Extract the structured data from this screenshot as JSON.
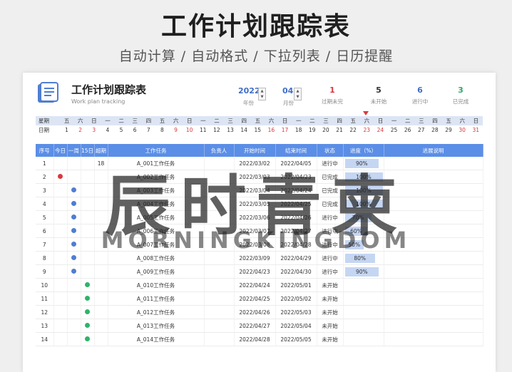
{
  "banner": {
    "title": "工作计划跟踪表",
    "subtitle": "自动计算 / 自动格式 / 下拉列表 / 日历提醒"
  },
  "header": {
    "title": "工作计划跟踪表",
    "subtitle": "Work plan tracking",
    "year": {
      "value": "2022",
      "label": "年份"
    },
    "month": {
      "value": "04",
      "label": "月份"
    },
    "stats": [
      {
        "value": "1",
        "label": "过期未完",
        "color": "#d9393e"
      },
      {
        "value": "5",
        "label": "未开始",
        "color": "#333333"
      },
      {
        "value": "6",
        "label": "进行中",
        "color": "#3f6dc9"
      },
      {
        "value": "3",
        "label": "已完成",
        "color": "#2fa866"
      }
    ]
  },
  "calendar": {
    "weekday_label": "星期",
    "date_label": "日期",
    "weekdays": [
      "五",
      "六",
      "日",
      "一",
      "二",
      "三",
      "四",
      "五",
      "六",
      "日",
      "一",
      "二",
      "三",
      "四",
      "五",
      "六",
      "日",
      "一",
      "二",
      "三",
      "四",
      "五",
      "六",
      "日",
      "一",
      "二",
      "三",
      "四",
      "五",
      "六",
      "日"
    ],
    "dates": [
      "1",
      "2",
      "3",
      "4",
      "5",
      "6",
      "7",
      "8",
      "9",
      "10",
      "11",
      "12",
      "13",
      "14",
      "15",
      "16",
      "17",
      "18",
      "19",
      "20",
      "21",
      "22",
      "23",
      "24",
      "25",
      "26",
      "27",
      "28",
      "29",
      "30",
      "31"
    ],
    "weekend_color": "#d9393e",
    "today_marker_date": "23"
  },
  "table": {
    "columns": [
      "序号",
      "今日",
      "一周",
      "15日",
      "超期",
      "工作任务",
      "负责人",
      "开始时间",
      "结束时间",
      "状态",
      "进度（%）",
      "进展说明"
    ],
    "rows": [
      {
        "no": "1",
        "dot": "",
        "dot_col": 0,
        "overdue": "18",
        "task": "A_001工作任务",
        "start": "2022/03/02",
        "end": "2022/04/05",
        "status": "进行中",
        "status_type": "go",
        "progress": "90%",
        "pct": 0.9
      },
      {
        "no": "2",
        "dot": "#d9393e",
        "dot_col": 1,
        "overdue": "",
        "task": "A_002工作任务",
        "start": "2022/03/03",
        "end": "2022/04/23",
        "status": "已完成",
        "status_type": "done",
        "progress": "100%",
        "pct": 1.0
      },
      {
        "no": "3",
        "dot": "#4f7ed1",
        "dot_col": 2,
        "overdue": "",
        "task": "A_003工作任务",
        "start": "2022/03/04",
        "end": "2022/04/24",
        "status": "已完成",
        "status_type": "done",
        "progress": "100%",
        "pct": 1.0
      },
      {
        "no": "4",
        "dot": "#4f7ed1",
        "dot_col": 2,
        "overdue": "",
        "task": "A_004工作任务",
        "start": "2022/03/05",
        "end": "2022/04/25",
        "status": "已完成",
        "status_type": "done",
        "progress": "100%",
        "pct": 1.0
      },
      {
        "no": "5",
        "dot": "#4f7ed1",
        "dot_col": 2,
        "overdue": "",
        "task": "A_005工作任务",
        "start": "2022/03/06",
        "end": "2022/04/26",
        "status": "进行中",
        "status_type": "go",
        "progress": "70%",
        "pct": 0.7
      },
      {
        "no": "6",
        "dot": "#4f7ed1",
        "dot_col": 2,
        "overdue": "",
        "task": "A_006工作任务",
        "start": "2022/03/07",
        "end": "2022/04/27",
        "status": "进行中",
        "status_type": "go",
        "progress": "60%",
        "pct": 0.6
      },
      {
        "no": "7",
        "dot": "#4f7ed1",
        "dot_col": 2,
        "overdue": "",
        "task": "A_007工作任务",
        "start": "2022/03/08",
        "end": "2022/04/28",
        "status": "进行中",
        "status_type": "go",
        "progress": "50%",
        "pct": 0.5
      },
      {
        "no": "8",
        "dot": "#4f7ed1",
        "dot_col": 2,
        "overdue": "",
        "task": "A_008工作任务",
        "start": "2022/03/09",
        "end": "2022/04/29",
        "status": "进行中",
        "status_type": "go",
        "progress": "80%",
        "pct": 0.8
      },
      {
        "no": "9",
        "dot": "#4f7ed1",
        "dot_col": 2,
        "overdue": "",
        "task": "A_009工作任务",
        "start": "2022/04/23",
        "end": "2022/04/30",
        "status": "进行中",
        "status_type": "go",
        "progress": "90%",
        "pct": 0.9
      },
      {
        "no": "10",
        "dot": "#2fb36b",
        "dot_col": 3,
        "overdue": "",
        "task": "A_010工作任务",
        "start": "2022/04/24",
        "end": "2022/05/01",
        "status": "未开始",
        "status_type": "wait",
        "progress": "",
        "pct": 0
      },
      {
        "no": "11",
        "dot": "#2fb36b",
        "dot_col": 3,
        "overdue": "",
        "task": "A_011工作任务",
        "start": "2022/04/25",
        "end": "2022/05/02",
        "status": "未开始",
        "status_type": "wait",
        "progress": "",
        "pct": 0
      },
      {
        "no": "12",
        "dot": "#2fb36b",
        "dot_col": 3,
        "overdue": "",
        "task": "A_012工作任务",
        "start": "2022/04/26",
        "end": "2022/05/03",
        "status": "未开始",
        "status_type": "wait",
        "progress": "",
        "pct": 0
      },
      {
        "no": "13",
        "dot": "#2fb36b",
        "dot_col": 3,
        "overdue": "",
        "task": "A_013工作任务",
        "start": "2022/04/27",
        "end": "2022/05/04",
        "status": "未开始",
        "status_type": "wait",
        "progress": "",
        "pct": 0
      },
      {
        "no": "14",
        "dot": "#2fb36b",
        "dot_col": 3,
        "overdue": "",
        "task": "A_014工作任务",
        "start": "2022/04/28",
        "end": "2022/05/05",
        "status": "未开始",
        "status_type": "wait",
        "progress": "",
        "pct": 0
      }
    ]
  },
  "watermark": {
    "cn": "辰时青柬",
    "en": "MORNINGKINGDOM"
  }
}
